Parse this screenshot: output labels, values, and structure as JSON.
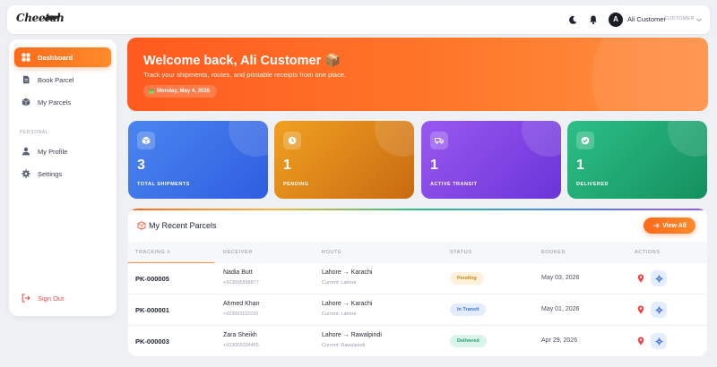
{
  "header": {
    "logo_text": "Cheetah",
    "user_initial": "A",
    "user_name": "Ali Customer",
    "user_role": "CUSTOMER"
  },
  "sidebar": {
    "items": [
      {
        "label": "Dashboard",
        "icon": "grid-icon",
        "active": true
      },
      {
        "label": "Book Parcel",
        "icon": "document-icon"
      },
      {
        "label": "My Parcels",
        "icon": "box-icon"
      }
    ],
    "section_label": "PERSONAL",
    "personal_items": [
      {
        "label": "My Profile",
        "icon": "user-icon"
      },
      {
        "label": "Settings",
        "icon": "gear-icon"
      }
    ],
    "signout_label": "Sign Out"
  },
  "banner": {
    "title": "Welcome back, Ali Customer 📦",
    "subtitle": "Track your shipments, routes, and printable receipts from one place.",
    "date": "Monday, May 4, 2026"
  },
  "stats": [
    {
      "value": "3",
      "label": "TOTAL SHIPMENTS",
      "icon": "box-icon",
      "color": "#3b72e8"
    },
    {
      "value": "1",
      "label": "PENDING",
      "icon": "clock-icon",
      "color": "#e08a1c"
    },
    {
      "value": "1",
      "label": "ACTIVE TRANSIT",
      "icon": "truck-icon",
      "color": "#7f46e6"
    },
    {
      "value": "1",
      "label": "DELIVERED",
      "icon": "check-circle-icon",
      "color": "#1fa874"
    }
  ],
  "recent": {
    "title": "My Recent Parcels",
    "view_all": "View All",
    "columns": [
      "TRACKING #",
      "RECEIVER",
      "ROUTE",
      "STATUS",
      "BOOKED",
      "ACTIONS"
    ],
    "rows": [
      {
        "tracking": "PK-000005",
        "receiver": "Nadia Butt",
        "phone": "+923005558877",
        "route": "Lahore → Karachi",
        "current": "Current: Lahore",
        "status": "Pending",
        "booked": "May 03, 2026"
      },
      {
        "tracking": "PK-000001",
        "receiver": "Ahmed Khan",
        "phone": "+923001112233",
        "route": "Lahore → Karachi",
        "current": "Current: Lahore",
        "status": "In Transit",
        "booked": "May 01, 2026"
      },
      {
        "tracking": "PK-000003",
        "receiver": "Zara Sheikh",
        "phone": "+923003334455",
        "route": "Lahore → Rawalpindi",
        "current": "Current: Rawalpindi",
        "status": "Delivered",
        "booked": "Apr 29, 2026"
      }
    ]
  }
}
